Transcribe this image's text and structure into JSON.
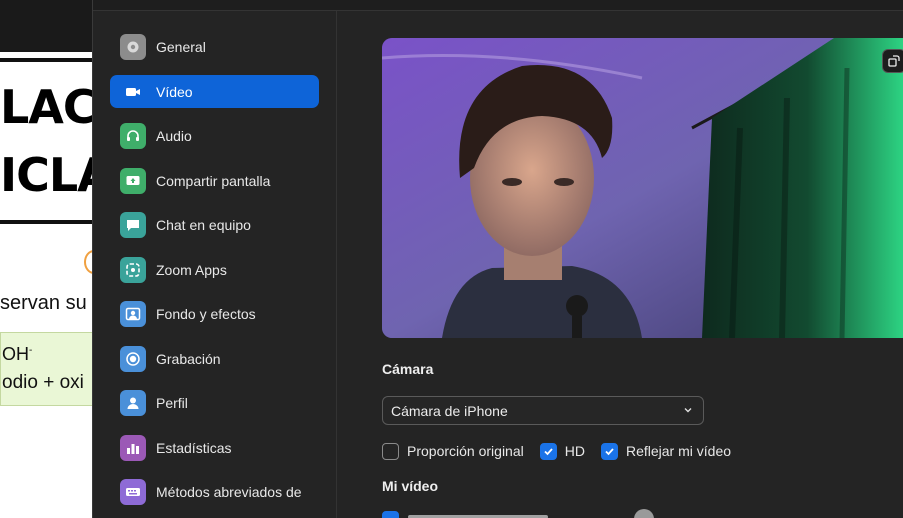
{
  "background_document": {
    "title_line1": "LAC",
    "title_line2": "ICLA",
    "text_line1": "servan su",
    "text_line2_main": "OH",
    "text_line2_sup": "-",
    "text_line3": "odio + oxi"
  },
  "sidebar": {
    "items": [
      {
        "label": "General",
        "icon": "gear-icon",
        "active": false
      },
      {
        "label": "Vídeo",
        "icon": "video-camera-icon",
        "active": true
      },
      {
        "label": "Audio",
        "icon": "headphones-icon",
        "active": false
      },
      {
        "label": "Compartir pantalla",
        "icon": "share-screen-icon",
        "active": false
      },
      {
        "label": "Chat en equipo",
        "icon": "chat-icon",
        "active": false
      },
      {
        "label": "Zoom Apps",
        "icon": "apps-icon",
        "active": false
      },
      {
        "label": "Fondo y efectos",
        "icon": "background-icon",
        "active": false
      },
      {
        "label": "Grabación",
        "icon": "record-icon",
        "active": false
      },
      {
        "label": "Perfil",
        "icon": "profile-icon",
        "active": false
      },
      {
        "label": "Estadísticas",
        "icon": "statistics-icon",
        "active": false
      },
      {
        "label": "Métodos abreviados de",
        "icon": "keyboard-icon",
        "active": false
      }
    ]
  },
  "camera": {
    "section_title": "Cámara",
    "selected_camera": "Cámara de iPhone",
    "options": [
      {
        "label": "Proporción original",
        "checked": false
      },
      {
        "label": "HD",
        "checked": true
      },
      {
        "label": "Reflejar mi vídeo",
        "checked": true
      }
    ]
  },
  "my_video": {
    "section_title": "Mi vídeo",
    "partial_option_checked": true
  },
  "colors": {
    "accent": "#0e64d8",
    "checkbox_on": "#1a73e8",
    "window_bg": "#242424"
  }
}
